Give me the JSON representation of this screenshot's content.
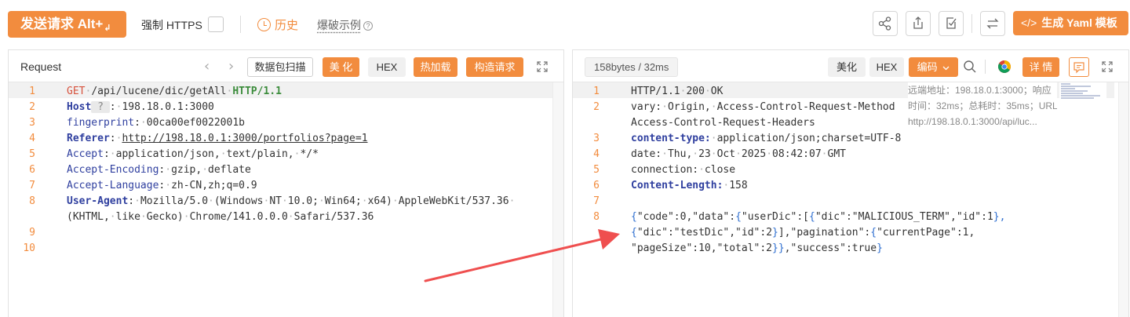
{
  "toolbar": {
    "send_label": "发送请求 Alt+",
    "send_enter_glyph": "↲",
    "https_label": "强制 HTTPS",
    "history_label": "历史",
    "burst_label": "爆破示例",
    "burst_help": "?",
    "yaml_code_glyph": "</>",
    "yaml_label": "生成 Yaml 模板",
    "icons": [
      "share-icon",
      "export-icon",
      "edit-check-icon",
      "swap-icon"
    ]
  },
  "request": {
    "title": "Request",
    "prev_glyph": "‹",
    "next_glyph": "›",
    "buttons": {
      "scan": "数据包扫描",
      "beautify": "美 化",
      "hex": "HEX",
      "hot_load": "热加载",
      "construct": "构造请求"
    },
    "lines": [
      {
        "num": "1",
        "segments": [
          {
            "t": "GET",
            "c": "method"
          },
          {
            "t": "·/api/lucene/dic/getAll·",
            "c": "mix"
          },
          {
            "t": "HTTP/1.1",
            "c": "proto"
          }
        ]
      },
      {
        "num": "2",
        "segments": [
          {
            "t": "Host",
            "c": "kw"
          },
          {
            "t": " ? ",
            "c": "hint"
          },
          {
            "t": ":·198.18.0.1:3000",
            "c": "mix"
          }
        ]
      },
      {
        "num": "3",
        "segments": [
          {
            "t": "fingerprint",
            "c": "kw-plain"
          },
          {
            "t": ":·00ca00ef0022001b",
            "c": "mix"
          }
        ]
      },
      {
        "num": "4",
        "segments": [
          {
            "t": "Referer",
            "c": "kw"
          },
          {
            "t": ":·",
            "c": "mix"
          },
          {
            "t": "http://198.18.0.1:3000/portfolios?page=1",
            "c": "url"
          }
        ]
      },
      {
        "num": "5",
        "segments": [
          {
            "t": "Accept",
            "c": "kw-plain"
          },
          {
            "t": ":·application/json,·text/plain,·*/*",
            "c": "mix"
          }
        ]
      },
      {
        "num": "6",
        "segments": [
          {
            "t": "Accept-Encoding",
            "c": "kw-plain"
          },
          {
            "t": ":·gzip,·deflate",
            "c": "mix"
          }
        ]
      },
      {
        "num": "7",
        "segments": [
          {
            "t": "Accept-Language",
            "c": "kw-plain"
          },
          {
            "t": ":·zh-CN,zh;q=0.9",
            "c": "mix"
          }
        ]
      },
      {
        "num": "8",
        "segments": [
          {
            "t": "User-Agent",
            "c": "kw"
          },
          {
            "t": ":·Mozilla/5.0·(Windows·NT·10.0;·Win64;·x64)·AppleWebKit/537.36·",
            "c": "mix"
          }
        ]
      },
      {
        "num": "",
        "segments": [
          {
            "t": "(KHTML,·like·Gecko)·Chrome/141.0.0.0·Safari/537.36",
            "c": "mix"
          }
        ]
      },
      {
        "num": "9",
        "segments": []
      },
      {
        "num": "10",
        "segments": []
      }
    ]
  },
  "response": {
    "size_label": "158bytes / 32ms",
    "buttons": {
      "beautify": "美化",
      "hex": "HEX",
      "encoding": "编码",
      "details": "详 情"
    },
    "tooltip": {
      "line1": "远端地址：198.18.0.1:3000；响应",
      "line2": "时间：32ms；总耗时：35ms；URL:",
      "line3": "http://198.18.0.1:3000/api/luc..."
    },
    "lines": [
      {
        "num": "1",
        "segments": [
          {
            "t": "HTTP/1.1·200·OK",
            "c": "mix"
          }
        ]
      },
      {
        "num": "2",
        "segments": [
          {
            "t": "vary:·Origin,·Access-Control-Request-Method",
            "c": "mix"
          }
        ]
      },
      {
        "num": "",
        "segments": [
          {
            "t": "Access-Control-Request-Headers",
            "c": "mix"
          }
        ]
      },
      {
        "num": "3",
        "segments": [
          {
            "t": "content-type:",
            "c": "kw"
          },
          {
            "t": "·application/json;charset=UTF-8",
            "c": "mix"
          }
        ]
      },
      {
        "num": "4",
        "segments": [
          {
            "t": "date:·Thu,·23·Oct·2025·08:42:07·GMT",
            "c": "mix"
          }
        ]
      },
      {
        "num": "5",
        "segments": [
          {
            "t": "connection:·close",
            "c": "mix"
          }
        ]
      },
      {
        "num": "6",
        "segments": [
          {
            "t": "Content-Length:",
            "c": "kw"
          },
          {
            "t": "·158",
            "c": "mix"
          }
        ]
      },
      {
        "num": "7",
        "segments": []
      },
      {
        "num": "8",
        "segments": [
          {
            "t": "{",
            "c": "brace"
          },
          {
            "t": "\"code\":0,\"data\":",
            "c": "plain"
          },
          {
            "t": "{",
            "c": "brace"
          },
          {
            "t": "\"userDic\":[",
            "c": "plain"
          },
          {
            "t": "{",
            "c": "brace"
          },
          {
            "t": "\"dic\":\"MALICIOUS_TERM\",\"id\":1",
            "c": "plain"
          },
          {
            "t": "},",
            "c": "brace"
          }
        ]
      },
      {
        "num": "",
        "segments": [
          {
            "t": "{",
            "c": "brace"
          },
          {
            "t": "\"dic\":\"testDic\",\"id\":2",
            "c": "plain"
          },
          {
            "t": "}",
            "c": "brace"
          },
          {
            "t": "],\"pagination\":",
            "c": "plain"
          },
          {
            "t": "{",
            "c": "brace"
          },
          {
            "t": "\"currentPage\":1,",
            "c": "plain"
          }
        ]
      },
      {
        "num": "",
        "segments": [
          {
            "t": "\"pageSize\":10,\"total\":2",
            "c": "plain"
          },
          {
            "t": "}}",
            "c": "brace"
          },
          {
            "t": ",\"success\":true",
            "c": "plain"
          },
          {
            "t": "}",
            "c": "brace"
          }
        ]
      }
    ]
  },
  "colors": {
    "accent": "#f28c3e",
    "keyword": "#2f3f9f",
    "method": "#d7513c",
    "protocol": "#3c8c3c",
    "arrow": "#ef4f4f"
  }
}
